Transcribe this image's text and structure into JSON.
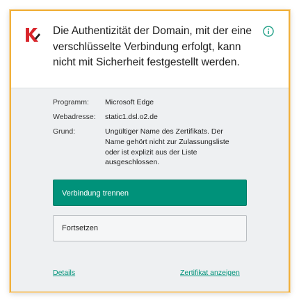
{
  "dialog": {
    "title": "Die Authentizität der Domain, mit der eine verschlüsselte Verbindung erfolgt, kann nicht mit Sicherheit festgestellt werden.",
    "logo_icon": "kaspersky-k-logo",
    "info_icon": "info-circle-icon",
    "accent_color": "#00927a",
    "frame_color": "#f0b03c"
  },
  "details": [
    {
      "label": "Programm:",
      "value": "Microsoft Edge"
    },
    {
      "label": "Webadresse:",
      "value": "static1.dsl.o2.de"
    },
    {
      "label": "Grund:",
      "value": "Ungültiger Name des Zertifikats. Der Name gehört nicht zur Zulassungsliste oder ist explizit aus der Liste ausgeschlossen."
    }
  ],
  "buttons": {
    "disconnect": "Verbindung trennen",
    "continue": "Fortsetzen"
  },
  "links": {
    "details": "Details",
    "view_certificate": "Zertifikat anzeigen"
  }
}
